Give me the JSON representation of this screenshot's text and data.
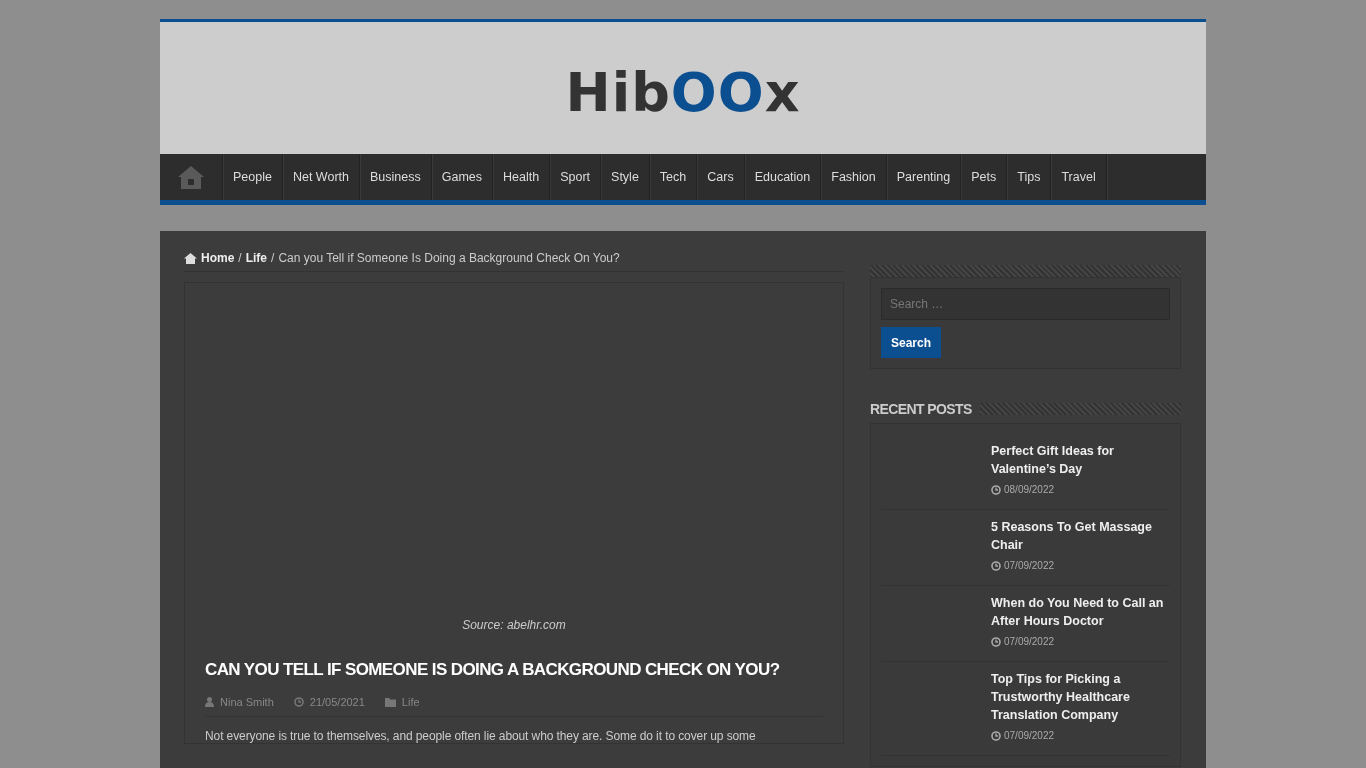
{
  "logo": {
    "parts": [
      "Hib",
      "OO",
      "x"
    ]
  },
  "nav": {
    "items": [
      {
        "label": "People"
      },
      {
        "label": "Net Worth"
      },
      {
        "label": "Business"
      },
      {
        "label": "Games"
      },
      {
        "label": "Health"
      },
      {
        "label": "Sport"
      },
      {
        "label": "Style"
      },
      {
        "label": "Tech"
      },
      {
        "label": "Cars"
      },
      {
        "label": "Education"
      },
      {
        "label": "Fashion"
      },
      {
        "label": "Parenting"
      },
      {
        "label": "Pets"
      },
      {
        "label": "Tips"
      },
      {
        "label": "Travel"
      }
    ]
  },
  "breadcrumb": {
    "links": [
      "Home",
      "Life"
    ],
    "separators": [
      "/",
      "/"
    ],
    "current": "Can you Tell if Someone Is Doing a Background Check On You?"
  },
  "article": {
    "caption": "Source: abelhr.com",
    "title": "CAN YOU TELL IF SOMEONE IS DOING A BACKGROUND CHECK ON YOU?",
    "author": "Nina Smith",
    "date": "21/05/2021",
    "category": "Life",
    "body": "Not everyone is true to themselves, and people often lie about who they are. Some do it to cover up some"
  },
  "sidebar": {
    "search": {
      "placeholder": "Search …",
      "button": "Search"
    },
    "recent_title": "RECENT POSTS",
    "posts": [
      {
        "title": "Perfect Gift Ideas for Valentine’s Day",
        "date": "08/09/2022"
      },
      {
        "title": "5 Reasons To Get Massage Chair",
        "date": "07/09/2022"
      },
      {
        "title": "When do You Need to Call an After Hours Doctor",
        "date": "07/09/2022"
      },
      {
        "title": "Top Tips for Picking a Trustworthy Healthcare Translation Company",
        "date": "07/09/2022"
      }
    ]
  }
}
